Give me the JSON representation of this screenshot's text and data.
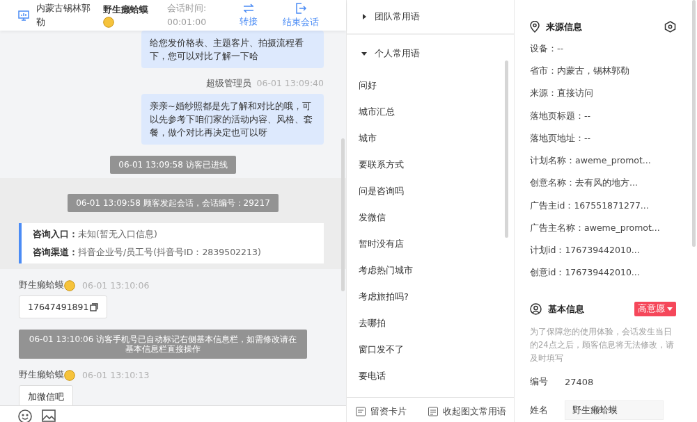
{
  "header": {
    "location": "内蒙古锡林郭勒",
    "visitor": "野生癞蛤蟆",
    "time_label": "会话时间:",
    "time_value": "00:01:00",
    "actions": [
      {
        "kind": "transfer",
        "label": "转接"
      },
      {
        "kind": "end",
        "label": "结束会话"
      }
    ]
  },
  "messages": [
    {
      "kind": "agent_bubble",
      "text": "给您发价格表、主题客片、拍摄流程看下，您可以对比了解一下哈"
    },
    {
      "kind": "agent_sender",
      "name": "超级管理员",
      "time": "06-01 13:09:40"
    },
    {
      "kind": "agent_bubble",
      "text": "亲亲~婚纱照都是先了解和对比的哦，可以先参考下咱们家的活动内容、风格、套餐，做个对比再决定也可以呀"
    },
    {
      "kind": "system",
      "text": "06-01 13:09:58 访客已进线"
    },
    {
      "kind": "band",
      "items": [
        {
          "kind": "system",
          "text": "06-01 13:09:58 顾客发起会话，会话编号：29217"
        },
        {
          "kind": "entry_card",
          "rows": [
            {
              "label": "咨询入口：",
              "value": "未知(暂无入口信息)"
            },
            {
              "label": "咨询渠道：",
              "value": "抖音企业号/员工号(抖音号ID：2839502213)"
            }
          ]
        }
      ]
    },
    {
      "kind": "visitor_sender",
      "name": "野生癞蛤蟆",
      "time": "06-01 13:10:06"
    },
    {
      "kind": "visitor_bubble",
      "text": "17647491891",
      "copy": true
    },
    {
      "kind": "system_wide",
      "text": "06-01 13:10:06 访客手机号已自动标记右侧基本信息栏，如需修改请在基本信息栏直接操作"
    },
    {
      "kind": "visitor_sender",
      "name": "野生癞蛤蟆",
      "time": "06-01 13:10:13"
    },
    {
      "kind": "visitor_bubble",
      "text": "加微信吧",
      "copy": false
    }
  ],
  "phrases": {
    "groups": [
      {
        "title": "团队常用语",
        "expanded": false
      },
      {
        "title": "个人常用语",
        "expanded": true,
        "items": [
          "问好",
          "城市汇总",
          "城市",
          "要联系方式",
          "问是咨询吗",
          "发微信",
          "暂时没有店",
          "考虑热门城市",
          "考虑旅拍吗?",
          "去哪拍",
          "窗口发不了",
          "要电话"
        ]
      }
    ],
    "footer": [
      {
        "kind": "card",
        "label": "留资卡片"
      },
      {
        "kind": "collapse",
        "label": "收起图文常用语"
      }
    ]
  },
  "source_info": {
    "title": "来源信息",
    "rows": [
      "设备：--",
      "省市：内蒙古，锡林郭勒",
      "来源：直接访问",
      "落地页标题：--",
      "落地页地址：--",
      "计划名称：aweme_promot...",
      "创意名称：去有风的地方...",
      "广告主id：167551871277...",
      "广告主名称：aweme_promot...",
      "计划id：176739442010...",
      "创意id：176739442010..."
    ]
  },
  "basic_info": {
    "title": "基本信息",
    "tag": "高意愿",
    "notice": "为了保障您的使用体验，会话发生当日的24点之后，顾客信息将无法修改，请及时填写",
    "fields": [
      {
        "label": "编号",
        "value": "27408",
        "kind": "text"
      },
      {
        "label": "姓名",
        "value": "野生癞蛤蟆",
        "kind": "input"
      }
    ]
  }
}
